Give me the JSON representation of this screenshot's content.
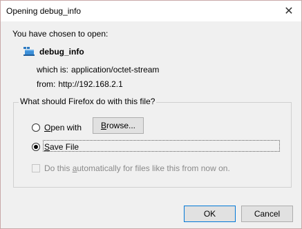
{
  "window": {
    "title": "Opening debug_info",
    "close_glyph": "✕"
  },
  "intro": "You have chosen to open:",
  "file": {
    "name": "debug_info",
    "icon": "file-generic-icon",
    "which_is_label": "which is:",
    "which_is_value": "application/octet-stream",
    "from_label": "from:",
    "from_value": "http://192.168.2.1"
  },
  "action_group": {
    "legend": "What should Firefox do with this file?",
    "open_with": {
      "mnemonic": "O",
      "rest": "pen with",
      "checked": false
    },
    "browse": {
      "mnemonic": "B",
      "rest": "rowse..."
    },
    "save_file": {
      "mnemonic": "S",
      "rest": "ave File",
      "checked": true
    },
    "auto": {
      "prefix": "Do this ",
      "mnemonic": "a",
      "rest": "utomatically for files like this from now on.",
      "checked": false,
      "enabled": false
    }
  },
  "buttons": {
    "ok": "OK",
    "cancel": "Cancel"
  },
  "colors": {
    "dialog_bg": "#f0f0f0",
    "default_button_border": "#0078d7",
    "disabled_text": "#8a8a8a"
  }
}
